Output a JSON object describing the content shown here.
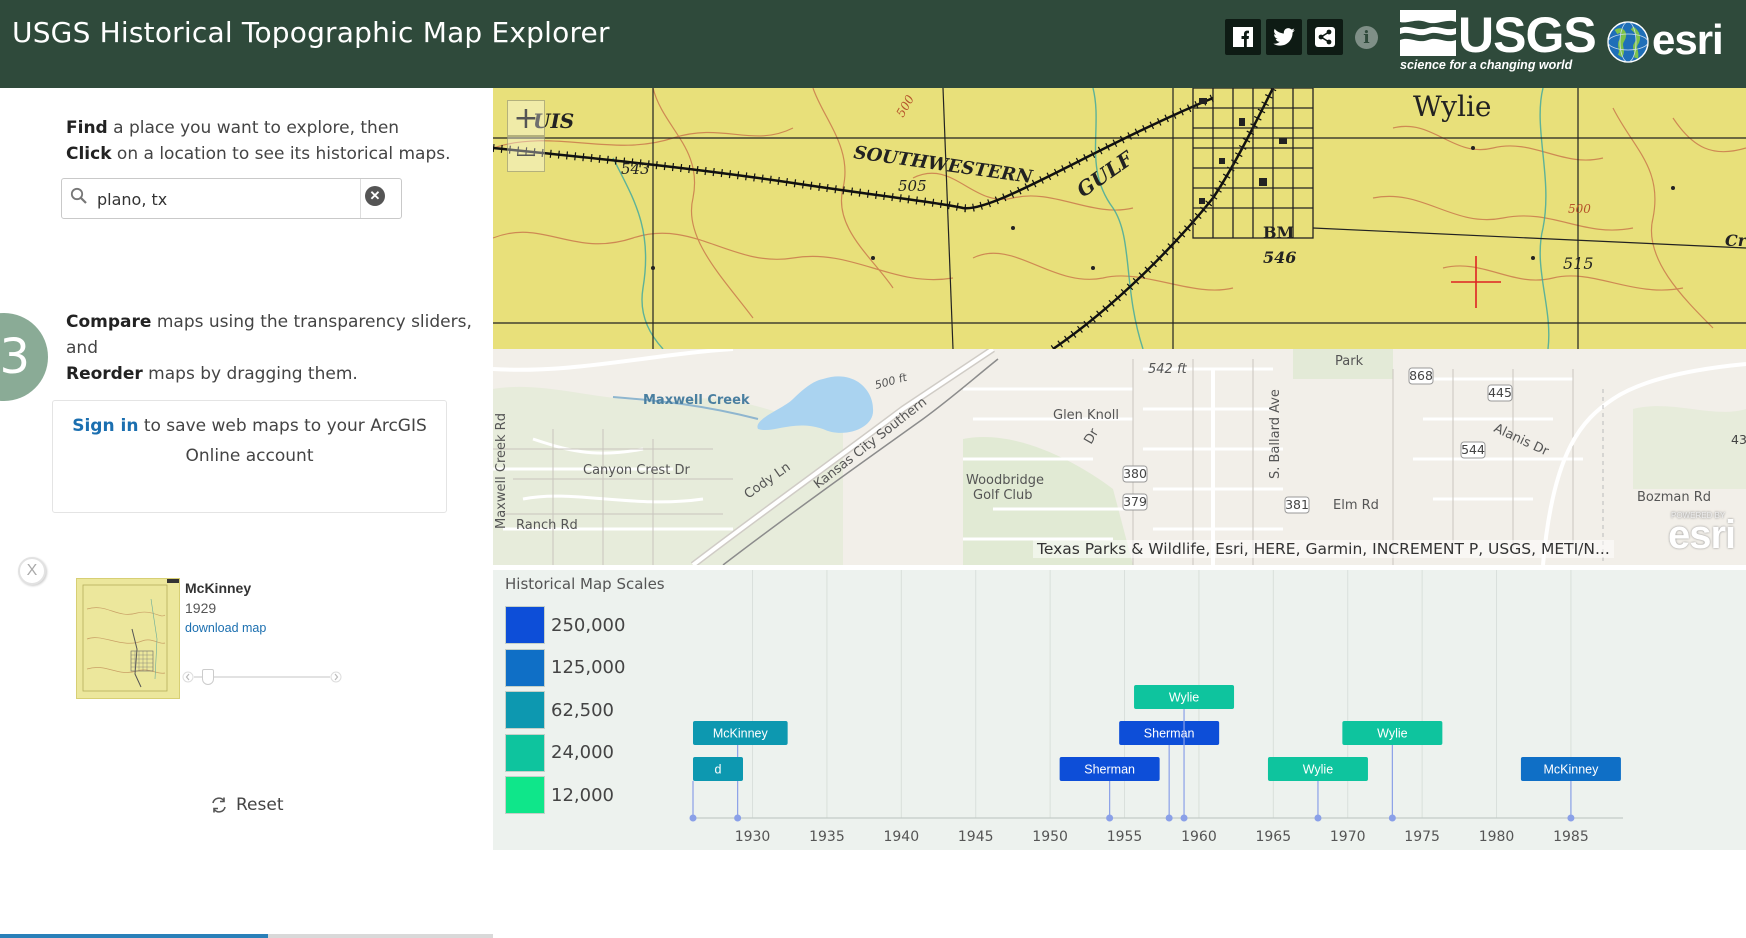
{
  "header": {
    "title": "USGS Historical Topographic Map Explorer",
    "usgs_logo": "USGS",
    "usgs_tagline": "science for a changing world",
    "esri_logo": "esri"
  },
  "sidebar": {
    "step2": {
      "find": "Find",
      "find_rest": " a place you want to explore, then",
      "click": "Click",
      "click_rest": " on a location to see its historical maps."
    },
    "search": {
      "value": "plano, tx"
    },
    "step3_number": "3",
    "step3": {
      "compare": "Compare",
      "compare_rest": " maps using the transparency sliders, and",
      "reorder": "Reorder",
      "reorder_rest": " maps by dragging them."
    },
    "signin": {
      "link": "Sign in",
      "rest": " to save web maps to your ArcGIS Online account"
    },
    "remove_label": "X",
    "map_item": {
      "name": "McKinney",
      "year": "1929",
      "download": "download map",
      "opacity": 0.1
    },
    "reset_label": "Reset"
  },
  "map": {
    "zoom_in": "+",
    "zoom_out": "—",
    "attribution": "Texas Parks & Wildlife, Esri, HERE, Garmin, INCREMENT P, USGS, METI/N...",
    "esri_powered": "POWERED BY",
    "esri_logo": "esri",
    "topo_labels": [
      "UIS",
      "SOUTHWESTERN",
      "GULF",
      "Wylie",
      "543",
      "505",
      "BM",
      "546",
      "515",
      "500",
      "500",
      "Cre"
    ],
    "basemap_labels": [
      "Maxwell Creek",
      "Glen Knoll",
      "Dr",
      "S. Ballard Ave",
      "Alanis Dr",
      "Canyon Crest Dr",
      "Cody Ln",
      "Kansas City Southern",
      "Woodbridge",
      "Golf Club",
      "Elm Rd",
      "Bozman Rd",
      "Ranch Rd",
      "Maxwell Creek Rd",
      "542 ft",
      "500 ft",
      "Park",
      "868",
      "445",
      "544",
      "380",
      "379",
      "381",
      "43"
    ]
  },
  "timeline": {
    "title": "Historical Map Scales",
    "legend": [
      {
        "label": "250,000",
        "color": "#0d4ed8"
      },
      {
        "label": "125,000",
        "color": "#0f6fc6"
      },
      {
        "label": "62,500",
        "color": "#0d98b0"
      },
      {
        "label": "24,000",
        "color": "#0ec49e"
      },
      {
        "label": "12,000",
        "color": "#0fe68a"
      }
    ],
    "axis_ticks": [
      "1930",
      "1935",
      "1940",
      "1945",
      "1950",
      "1955",
      "1960",
      "1965",
      "1970",
      "1975",
      "1980",
      "1985"
    ],
    "items": [
      {
        "name": "McKinney",
        "year": 1929,
        "scale": "62,500",
        "row": 2
      },
      {
        "name": "d",
        "year": 1926,
        "scale": "62,500",
        "row": 1
      },
      {
        "name": "Sherman",
        "year": 1954,
        "scale": "250,000",
        "row": 1
      },
      {
        "name": "Sherman",
        "year": 1958,
        "scale": "250,000",
        "row": 2
      },
      {
        "name": "Wylie",
        "year": 1959,
        "scale": "24,000",
        "row": 3
      },
      {
        "name": "Wylie",
        "year": 1968,
        "scale": "24,000",
        "row": 1
      },
      {
        "name": "Wylie",
        "year": 1973,
        "scale": "24,000",
        "row": 2
      },
      {
        "name": "McKinney",
        "year": 1985,
        "scale": "125,000",
        "row": 1
      }
    ]
  }
}
